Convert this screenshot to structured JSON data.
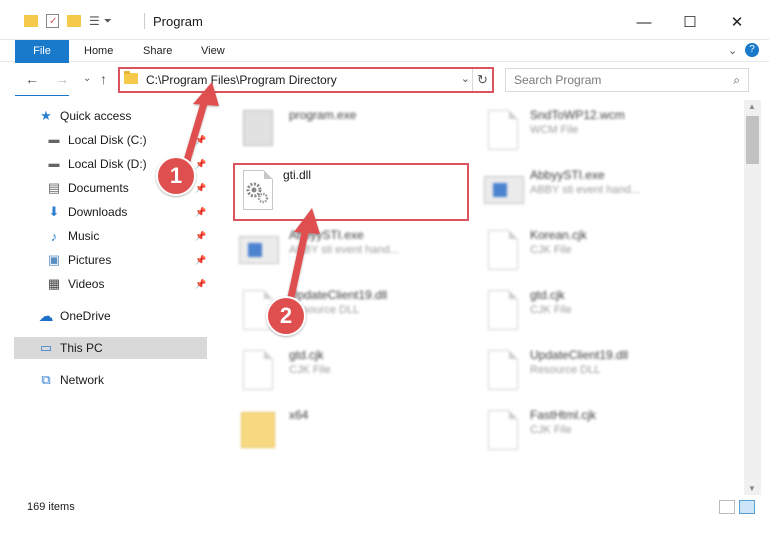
{
  "window": {
    "title": "Program",
    "minimize": "—",
    "maximize": "☐",
    "close": "✕"
  },
  "ribbon": {
    "tabs": [
      "File",
      "Home",
      "Share",
      "View"
    ],
    "collapse": "⌄",
    "help": "?"
  },
  "nav": {
    "back": "←",
    "forward": "→",
    "recent": "⌄",
    "up": "↑",
    "address": "C:\\Program Files\\Program Directory",
    "address_dropdown": "⌄",
    "refresh": "↻",
    "search_placeholder": "Search Program",
    "search_icon": "⌕"
  },
  "sidebar": {
    "items": [
      {
        "label": "Quick access",
        "icon": "star-icon",
        "glyph": "★",
        "pinned": false
      },
      {
        "label": "Local Disk (C:)",
        "icon": "drive-icon",
        "glyph": "▬",
        "pinned": true
      },
      {
        "label": "Local Disk (D:)",
        "icon": "drive-icon",
        "glyph": "▬",
        "pinned": true
      },
      {
        "label": "Documents",
        "icon": "documents-icon",
        "glyph": "▤",
        "pinned": true
      },
      {
        "label": "Downloads",
        "icon": "download-icon",
        "glyph": "⬇",
        "pinned": true
      },
      {
        "label": "Music",
        "icon": "music-icon",
        "glyph": "♪",
        "pinned": true
      },
      {
        "label": "Pictures",
        "icon": "pictures-icon",
        "glyph": "▣",
        "pinned": true
      },
      {
        "label": "Videos",
        "icon": "videos-icon",
        "glyph": "▦",
        "pinned": true
      },
      {
        "label": "OneDrive",
        "icon": "cloud-icon",
        "glyph": "☁",
        "pinned": false
      },
      {
        "label": "This PC",
        "icon": "computer-icon",
        "glyph": "▭",
        "pinned": false
      },
      {
        "label": "Network",
        "icon": "network-icon",
        "glyph": "⧉",
        "pinned": false
      }
    ],
    "pin_glyph": "📌"
  },
  "files": [
    {
      "name": "program.exe",
      "type": "",
      "icon": "exe-icon"
    },
    {
      "name": "SndToWP12.wcm",
      "type": "WCM File",
      "icon": "document-icon"
    },
    {
      "name": "gti.dll",
      "type": "",
      "icon": "dll-gear-icon"
    },
    {
      "name": "AbbyySTI.exe",
      "type": "ABBY sti event hand...",
      "icon": "app-window-icon"
    },
    {
      "name": "AbbyySTI.exe",
      "type": "ABBY sti event hand...",
      "icon": "app-window-icon"
    },
    {
      "name": "Korean.cjk",
      "type": "CJK File",
      "icon": "document-icon"
    },
    {
      "name": "UpdateClient19.dll",
      "type": "Resource DLL",
      "icon": "dll-gear-icon"
    },
    {
      "name": "gtd.cjk",
      "type": "CJK File",
      "icon": "document-icon"
    },
    {
      "name": "gtd.cjk",
      "type": "CJK File",
      "icon": "document-icon"
    },
    {
      "name": "UpdateClient19.dll",
      "type": "Resource DLL",
      "icon": "dll-gear-icon"
    },
    {
      "name": "x64",
      "type": "",
      "icon": "folder-icon"
    },
    {
      "name": "FastHtml.cjk",
      "type": "CJK File",
      "icon": "document-icon"
    }
  ],
  "status": {
    "item_count": "169 items"
  },
  "annotations": {
    "step1": "1",
    "step2": "2",
    "accent": "#e04f4f"
  }
}
